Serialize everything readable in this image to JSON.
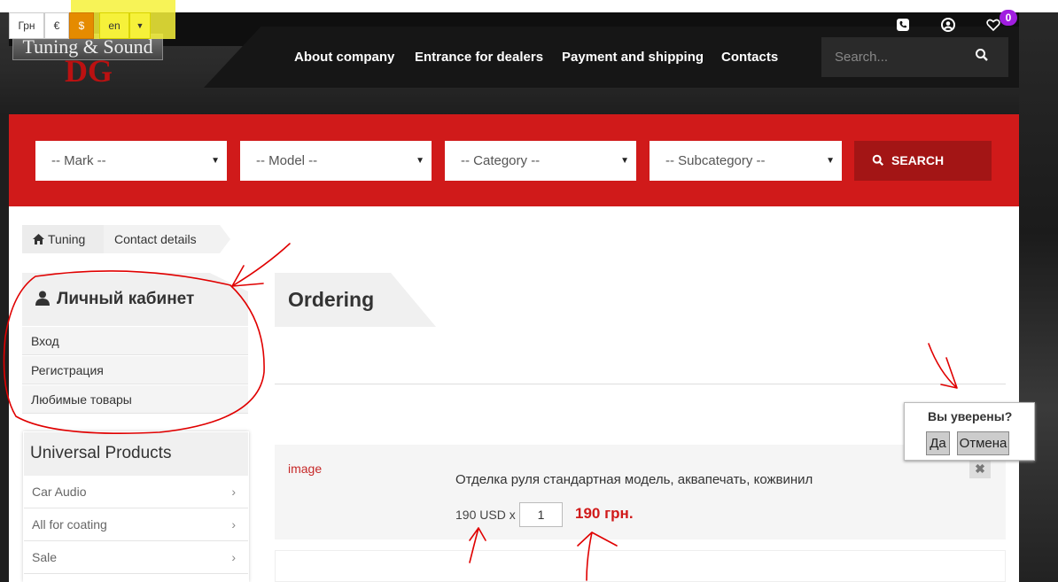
{
  "topbar": {
    "currencies": [
      "Грн",
      "€",
      "$"
    ],
    "language": "en",
    "cart_count": "0"
  },
  "logo": {
    "text": "Tuning & Sound",
    "mark": "DG"
  },
  "nav": {
    "items": [
      "About company",
      "Entrance for dealers",
      "Payment and shipping",
      "Contacts"
    ],
    "search_placeholder": "Search..."
  },
  "filters": {
    "mark": "-- Mark --",
    "model": "-- Model --",
    "category": "-- Category --",
    "subcategory": "-- Subcategory --",
    "search_label": "SEARCH"
  },
  "breadcrumb": {
    "home": "Tuning",
    "current": "Contact details"
  },
  "cabinet": {
    "title": "Личный кабинет",
    "items": [
      "Вход",
      "Регистрация",
      "Любимые товары"
    ]
  },
  "universal": {
    "title": "Universal Products",
    "items": [
      "Car Audio",
      "All for coating",
      "Sale"
    ]
  },
  "order": {
    "title": "Ordering",
    "image_label": "image",
    "product_name": "Отделка руля стандартная модель, аквапечать, кожвинил",
    "unit_price": "190 USD x",
    "quantity": "1",
    "total": "190 грн."
  },
  "confirm": {
    "question": "Вы уверены?",
    "yes": "Да",
    "no": "Отмена"
  },
  "colors": {
    "accent": "#d01a1a",
    "dark": "#161616",
    "badge": "#a11ee0",
    "highlight": "#f6f13a"
  }
}
